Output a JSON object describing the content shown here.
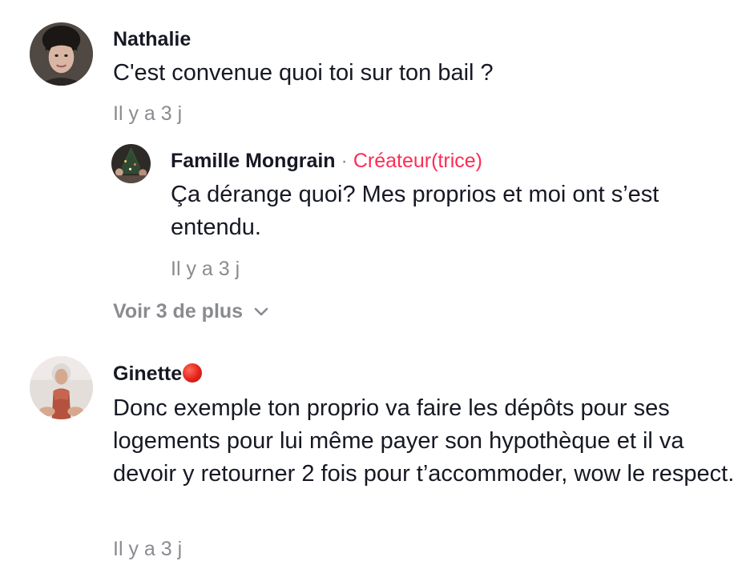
{
  "comments": [
    {
      "username": "Nathalie",
      "text": "C'est convenue quoi toi sur ton bail ?",
      "timestamp": "Il y a 3 j",
      "avatar_icon": "user-avatar"
    },
    {
      "username": "Ginette",
      "text": "Donc exemple ton proprio va faire les dépôts pour ses logements pour lui même payer son hypothèque et il va devoir y retourner 2 fois pour t’accommoder, wow le respect.",
      "timestamp": "Il y a 3 j",
      "avatar_icon": "user-avatar",
      "status_emoji": "red-circle"
    }
  ],
  "reply": {
    "username": "Famille Mongrain",
    "separator": "·",
    "creator_label": "Créateur(trice)",
    "text": "Ça dérange quoi? Mes proprios et moi ont s’est entendu.",
    "timestamp": "Il y a 3 j",
    "avatar_icon": "user-avatar"
  },
  "view_more": {
    "label": "Voir 3 de plus",
    "icon": "chevron-down-icon"
  },
  "colors": {
    "text": "#161823",
    "muted": "#8a8b91",
    "creator": "#fe2c55",
    "status_dot": "#e3221a"
  }
}
